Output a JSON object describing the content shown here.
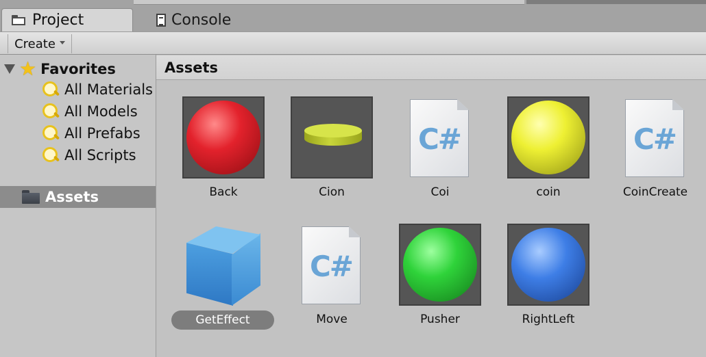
{
  "tabs": [
    {
      "label": "Project",
      "icon": "folder-icon",
      "active": true
    },
    {
      "label": "Console",
      "icon": "console-icon",
      "active": false
    }
  ],
  "toolbar": {
    "create_label": "Create"
  },
  "sidebar": {
    "favorites_label": "Favorites",
    "favorites": [
      {
        "label": "All Materials",
        "icon": "search-icon"
      },
      {
        "label": "All Models",
        "icon": "search-icon"
      },
      {
        "label": "All Prefabs",
        "icon": "search-icon"
      },
      {
        "label": "All Scripts",
        "icon": "search-icon"
      }
    ],
    "assets_label": "Assets"
  },
  "main": {
    "header": "Assets",
    "items": [
      {
        "name": "Back",
        "kind": "material",
        "color": "#e3222c"
      },
      {
        "name": "Cion",
        "kind": "cylinder",
        "color": "#cfdc3e"
      },
      {
        "name": "Coi",
        "kind": "script",
        "glyph": "C#"
      },
      {
        "name": "coin",
        "kind": "material",
        "color": "#eef033"
      },
      {
        "name": "CoinCreate",
        "kind": "script",
        "glyph": "C#"
      },
      {
        "name": "GetEffect",
        "kind": "prefab",
        "selected": true
      },
      {
        "name": "Move",
        "kind": "script",
        "glyph": "C#"
      },
      {
        "name": "Pusher",
        "kind": "material",
        "color": "#2fd33a"
      },
      {
        "name": "RightLeft",
        "kind": "material",
        "color": "#3e7ee6"
      }
    ]
  }
}
